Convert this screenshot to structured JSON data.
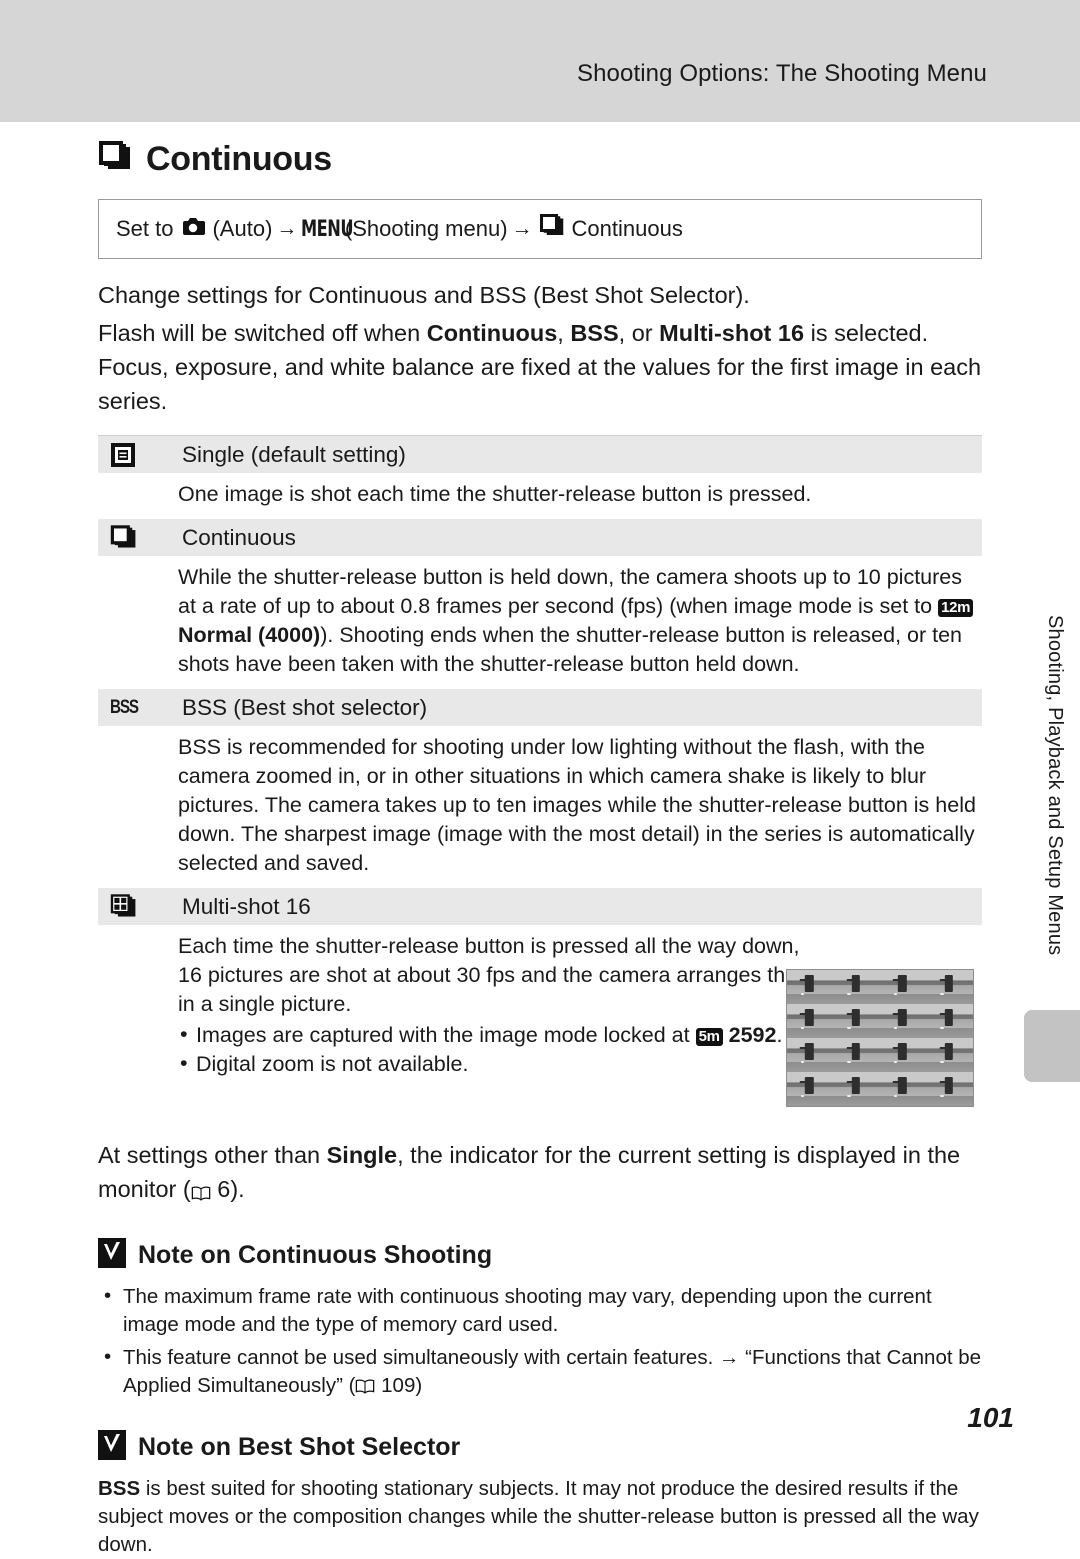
{
  "banner": {
    "title": "Shooting Options: The Shooting Menu"
  },
  "section": {
    "icon": "continuous-stack-icon",
    "title": "Continuous"
  },
  "instruction": {
    "prefix": "Set to",
    "camera_icon": "camera-auto-icon",
    "auto_label": "(Auto)",
    "arrow1": "→",
    "menu_label": "MENU",
    "menu_paren": "(Shooting menu)",
    "arrow2": "→",
    "continuous_icon": "continuous-stack-icon",
    "continuous_label": "Continuous"
  },
  "intro": {
    "paragraph1": "Change settings for Continuous and BSS (Best Shot Selector).",
    "paragraph2_part1": "Flash will be switched off when ",
    "paragraph2_bold1": "Continuous",
    "paragraph2_sep1": ", ",
    "paragraph2_bold2": "BSS",
    "paragraph2_sep2": ", or ",
    "paragraph2_bold3": "Multi-shot 16",
    "paragraph2_part2": " is selected. Focus, exposure, and white balance are fixed at the values for the first image in each series."
  },
  "options": [
    {
      "icon": "single-shot-icon",
      "label": "Single (default setting)",
      "description": "One image is shot each time the shutter-release button is pressed."
    },
    {
      "icon": "continuous-stack-icon",
      "label": "Continuous",
      "desc_part1": "While the shutter-release button is held down, the camera shoots up to 10 pictures at a rate of up to about 0.8 frames per second (fps) (when image mode is set to ",
      "badge": "12m",
      "desc_bold": "Normal (4000)",
      "desc_part2": "). Shooting ends when the shutter-release button is released, or ten shots have been taken with the shutter-release button held down."
    },
    {
      "icon": "bss-icon",
      "icon_text": "BSS",
      "label": "BSS (Best shot selector)",
      "description": "BSS is recommended for shooting under low lighting without the flash, with the camera zoomed in, or in other situations in which camera shake is likely to blur pictures. The camera takes up to ten images while the shutter-release button is held down. The sharpest image (image with the most detail) in the series is automatically selected and saved."
    },
    {
      "icon": "multi-shot-grid-icon",
      "label": "Multi-shot 16",
      "description": "Each time the shutter-release button is pressed all the way down, 16 pictures are shot at about 30 fps and the camera arranges them in a single picture.",
      "bullet1_part1": "Images are captured with the image mode locked at ",
      "bullet1_badge": "5m",
      "bullet1_bold": "2592",
      "bullet1_part2": ".",
      "bullet2": "Digital zoom is not available.",
      "thumbnail_alt": "multi-shot-16-sample-thumbnail"
    }
  ],
  "after_table": {
    "part1": "At settings other than ",
    "bold": "Single",
    "part2": ", the indicator for the current setting is displayed in the monitor (",
    "book_icon": "book-reference-icon",
    "page_ref": " 6).",
    "part3": ""
  },
  "notes": [
    {
      "icon": "check-mark-icon",
      "title": "Note on Continuous Shooting",
      "bullets": [
        "The maximum frame rate with continuous shooting may vary, depending upon the current image mode and the type of memory card used.",
        "This feature cannot be used simultaneously with certain features. → “Functions that Cannot be Applied Simultaneously” ("
      ],
      "bullet2_page_ref": " 109)"
    },
    {
      "icon": "check-mark-icon",
      "title": "Note on Best Shot Selector",
      "para_bold": "BSS",
      "para_rest": " is best suited for shooting stationary subjects. It may not produce the desired results if the subject moves or the composition changes while the shutter-release button is pressed all the way down."
    }
  ],
  "sidebar": {
    "text": "Shooting, Playback and Setup Menus"
  },
  "page_number": "101",
  "colors": {
    "banner_bg": "#d6d6d6",
    "row_head_bg": "#e8e8e8",
    "side_tab_bg": "#c3c3c3",
    "text": "#1a1a1a"
  }
}
